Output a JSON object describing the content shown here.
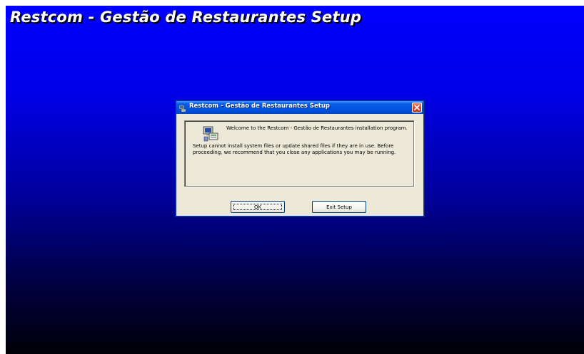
{
  "background": {
    "title": "Restcom - Gestão de Restaurantes Setup",
    "gradient_top": "#0000ff",
    "gradient_bottom": "#000008"
  },
  "dialog": {
    "title": "Restcom - Gestão de Restaurantes Setup",
    "icon": "setup-app-icon",
    "close_icon": "close-x-icon",
    "welcome_text": "Welcome to the Restcom - Gestão de Restaurantes installation program.",
    "warning_text": "Setup cannot install system files or update shared files if they are in use. Before proceeding, we recommend that you close any applications you may be running.",
    "buttons": {
      "ok_label": "OK",
      "exit_label": "Exit Setup"
    },
    "titlebar_color": "#0054e3",
    "close_color": "#d9492a",
    "face_color": "#ece9d8"
  }
}
